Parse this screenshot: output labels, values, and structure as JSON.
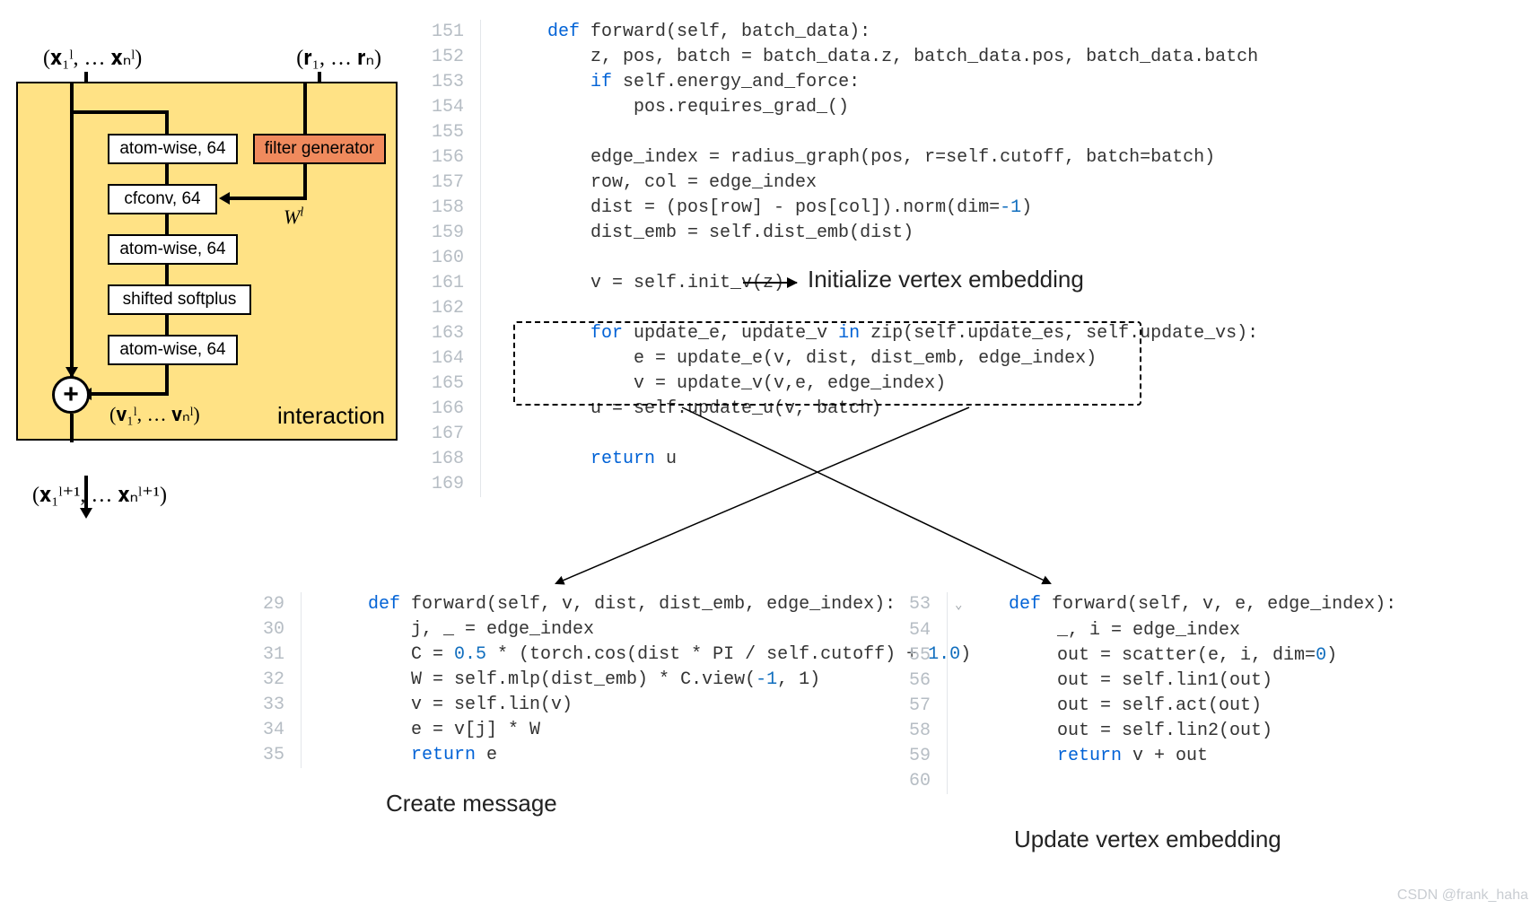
{
  "diagram": {
    "input_x": "(𝐱₁ˡ, … 𝐱ₙˡ)",
    "input_r": "(𝐫₁, … 𝐫ₙ)",
    "blocks": {
      "atom1": "atom-wise, 64",
      "filter": "filter generator",
      "cfconv": "cfconv, 64",
      "atom2": "atom-wise, 64",
      "ssp": "shifted softplus",
      "atom3": "atom-wise, 64"
    },
    "w_label": "Wˡ",
    "v_label": "(𝐯₁ˡ, … 𝐯ₙˡ)",
    "interaction": "interaction",
    "output_x": "(𝐱₁ˡ⁺¹, … 𝐱ₙˡ⁺¹)"
  },
  "annotations": {
    "init_vertex": "Initialize vertex embedding",
    "create_msg": "Create message",
    "update_vertex": "Update vertex embedding"
  },
  "code_main": [
    {
      "n": "151",
      "t": "    def forward(self, batch_data):",
      "cls": ""
    },
    {
      "n": "152",
      "t": "        z, pos, batch = batch_data.z, batch_data.pos, batch_data.batch",
      "cls": ""
    },
    {
      "n": "153",
      "t": "        if self.energy_and_force:",
      "cls": ""
    },
    {
      "n": "154",
      "t": "            pos.requires_grad_()",
      "cls": ""
    },
    {
      "n": "155",
      "t": "",
      "cls": ""
    },
    {
      "n": "156",
      "t": "        edge_index = radius_graph(pos, r=self.cutoff, batch=batch)",
      "cls": ""
    },
    {
      "n": "157",
      "t": "        row, col = edge_index",
      "cls": ""
    },
    {
      "n": "158",
      "t": "        dist = (pos[row] - pos[col]).norm(dim=-1)",
      "cls": ""
    },
    {
      "n": "159",
      "t": "        dist_emb = self.dist_emb(dist)",
      "cls": ""
    },
    {
      "n": "160",
      "t": "",
      "cls": ""
    },
    {
      "n": "161",
      "t": "        v = self.init_v(z)",
      "cls": ""
    },
    {
      "n": "162",
      "t": "",
      "cls": ""
    },
    {
      "n": "163",
      "t": "        for update_e, update_v in zip(self.update_es, self.update_vs):",
      "cls": ""
    },
    {
      "n": "164",
      "t": "            e = update_e(v, dist, dist_emb, edge_index)",
      "cls": ""
    },
    {
      "n": "165",
      "t": "            v = update_v(v,e, edge_index)",
      "cls": ""
    },
    {
      "n": "166",
      "t": "        u = self.update_u(v, batch)",
      "cls": ""
    },
    {
      "n": "167",
      "t": "",
      "cls": ""
    },
    {
      "n": "168",
      "t": "        return u",
      "cls": ""
    },
    {
      "n": "169",
      "t": "",
      "cls": ""
    }
  ],
  "code_left": [
    {
      "n": "29",
      "t": "    def forward(self, v, dist, dist_emb, edge_index):"
    },
    {
      "n": "30",
      "t": "        j, _ = edge_index"
    },
    {
      "n": "31",
      "t": "        C = 0.5 * (torch.cos(dist * PI / self.cutoff) + 1.0)"
    },
    {
      "n": "32",
      "t": "        W = self.mlp(dist_emb) * C.view(-1, 1)"
    },
    {
      "n": "33",
      "t": "        v = self.lin(v)"
    },
    {
      "n": "34",
      "t": "        e = v[j] * W"
    },
    {
      "n": "35",
      "t": "        return e"
    }
  ],
  "code_right": [
    {
      "n": "53",
      "t": "    def forward(self, v, e, edge_index):"
    },
    {
      "n": "54",
      "t": "        _, i = edge_index"
    },
    {
      "n": "55",
      "t": "        out = scatter(e, i, dim=0)"
    },
    {
      "n": "56",
      "t": "        out = self.lin1(out)"
    },
    {
      "n": "57",
      "t": "        out = self.act(out)"
    },
    {
      "n": "58",
      "t": "        out = self.lin2(out)"
    },
    {
      "n": "59",
      "t": "        return v + out"
    },
    {
      "n": "60",
      "t": ""
    }
  ],
  "watermark": "CSDN @frank_haha",
  "syntax": {
    "keywords": [
      "def",
      "if",
      "for",
      "in",
      "return"
    ],
    "numbers": [
      "-1",
      "0.5",
      "1.0",
      "1",
      "0"
    ]
  }
}
